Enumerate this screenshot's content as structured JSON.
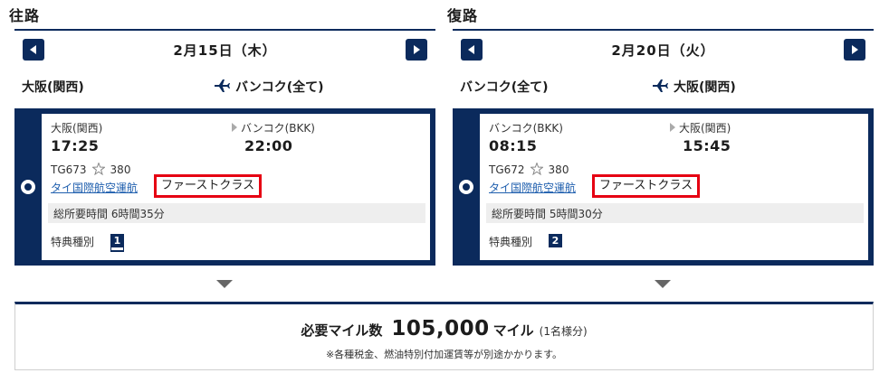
{
  "outbound": {
    "title": "往路",
    "date": "2月15日（木）",
    "route_from": "大阪(関西)",
    "route_to": "バンコク(全て)",
    "flight": {
      "dep_airport": "大阪(関西)",
      "arr_airport": "バンコク(BKK)",
      "dep_time": "17:25",
      "arr_time": "22:00",
      "flight_no": "TG673",
      "aircraft": "380",
      "airline": "タイ国際航空運航",
      "cabin": "ファーストクラス",
      "duration": "総所要時間 6時間35分",
      "award_label": "特典種別",
      "award_type": "1"
    }
  },
  "return": {
    "title": "復路",
    "date": "2月20日（火）",
    "route_from": "バンコク(全て)",
    "route_to": "大阪(関西)",
    "flight": {
      "dep_airport": "バンコク(BKK)",
      "arr_airport": "大阪(関西)",
      "dep_time": "08:15",
      "arr_time": "15:45",
      "flight_no": "TG672",
      "aircraft": "380",
      "airline": "タイ国際航空運航",
      "cabin": "ファーストクラス",
      "duration": "総所要時間 5時間30分",
      "award_label": "特典種別",
      "award_type": "2"
    }
  },
  "summary": {
    "label": "必要マイル数",
    "value": "105,000",
    "unit": "マイル",
    "per_person": "(1名様分)",
    "note": "※各種税金、燃油特別付加運賃等が別途かかります。"
  },
  "colors": {
    "navy": "#0b2a5c",
    "highlight_red": "#e60012",
    "link_blue": "#1f5fae"
  },
  "icons": [
    "chevron-left-icon",
    "chevron-right-icon",
    "airplane-icon",
    "star-alliance-icon",
    "down-arrow-icon"
  ]
}
